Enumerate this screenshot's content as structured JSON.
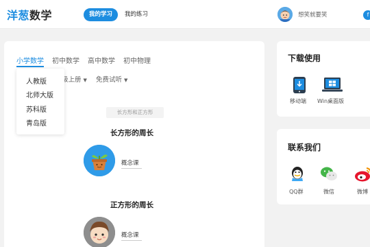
{
  "header": {
    "logo_part1": "洋葱",
    "logo_part2": "数学",
    "nav": [
      "我的学习",
      "我的练习"
    ],
    "username": "想笑就要笑"
  },
  "main": {
    "tabs": [
      "小学数学",
      "初中数学",
      "高中数学",
      "初中物理"
    ],
    "filters": [
      "级上册",
      "免费试听"
    ],
    "dropdown": [
      "人教版",
      "北师大版",
      "苏科版",
      "青岛版"
    ],
    "section_tag": "长方形和正方形",
    "lessons": [
      {
        "title": "长方形的周长",
        "type": "概念课"
      },
      {
        "title": "正方形的周长",
        "type": "概念课"
      }
    ]
  },
  "download": {
    "title": "下载使用",
    "items": [
      "移动端",
      "Win桌面版"
    ]
  },
  "contact": {
    "title": "联系我们",
    "items": [
      "QQ群",
      "微信",
      "微博"
    ]
  },
  "colors": {
    "accent": "#1d8de0",
    "background": "#f2f2f2"
  }
}
